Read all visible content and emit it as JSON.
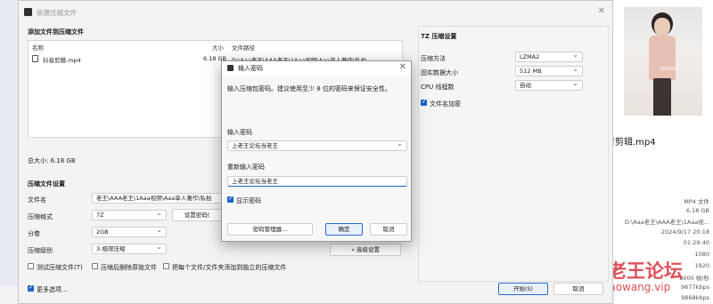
{
  "main_window": {
    "title": "新建压缩文件",
    "add_section_title": "添加文件到压缩文件",
    "columns": {
      "name": "名称",
      "size": "大小",
      "path": "文件路径"
    },
    "files": [
      {
        "name": "抖音剪辑.mp4",
        "size": "6.18 GB",
        "path": "D:\\Aaa老王\\AAA老王\\1Aaa视频\\Aaa单人著作\\私拍"
      }
    ],
    "total_size": "总大小: 6.18 GB",
    "settings_title": "压缩文件设置",
    "archive_name_label": "文件名",
    "archive_name_value": "老王\\AAA老王\\1Aaa视频\\Aaa单人著作\\私拍",
    "format_label": "压缩格式",
    "format_value": "7Z",
    "set_password_button": "设置密码(",
    "split_label": "分卷",
    "split_value": "2GB",
    "level_label": "压缩级别",
    "level_value": "3-极限压缩",
    "advanced_button": "« 高级设置",
    "test_archive": "测试压缩文件(T)",
    "delete_after": "压缩后删除原始文件",
    "separate_archives": "把每个文件/文件夹添加到独立的压缩文件",
    "more_options": "更多选项...",
    "start_button": "开始(S)",
    "cancel_button": "取消"
  },
  "seven_zip_settings": {
    "title": "7Z 压缩设置",
    "method_label": "压缩方法",
    "method_value": "LZMA2",
    "dict_label": "固实数据大小",
    "dict_value": "512 MB",
    "threads_label": "CPU 线程数",
    "threads_value": "自动",
    "encrypt_names": "文件名加密"
  },
  "password_dialog": {
    "title": "输入密码",
    "hint": "输入压缩包密码。建议使用至少 8 位的密码来保证安全性。",
    "enter_label": "输入密码",
    "enter_value": "上老王论坛当老王",
    "reenter_label": "重新输入密码",
    "reenter_value": "上老王论坛当老王",
    "show_password": "显示密码",
    "manager_button": "密码管理器...",
    "ok_button": "确定",
    "cancel_button": "取消"
  },
  "preview": {
    "watermark_on_photo": "@Xiam",
    "file_name": "音剪辑.mp4",
    "properties": [
      "MP4 文件",
      "6.18 GB",
      "D:\\Aaa老王\\AAA老王\\1Aaa视...",
      "2024/9/17 20:18",
      "01:29:40",
      "1080",
      "1920",
      "3000 帧/秒",
      "9677kbps",
      "9868kbps"
    ],
    "watermark_big": "老王论坛",
    "watermark_url": "laowang.vip"
  },
  "colors": {
    "accent": "#1f62c8",
    "watermark": "#d7323c"
  }
}
